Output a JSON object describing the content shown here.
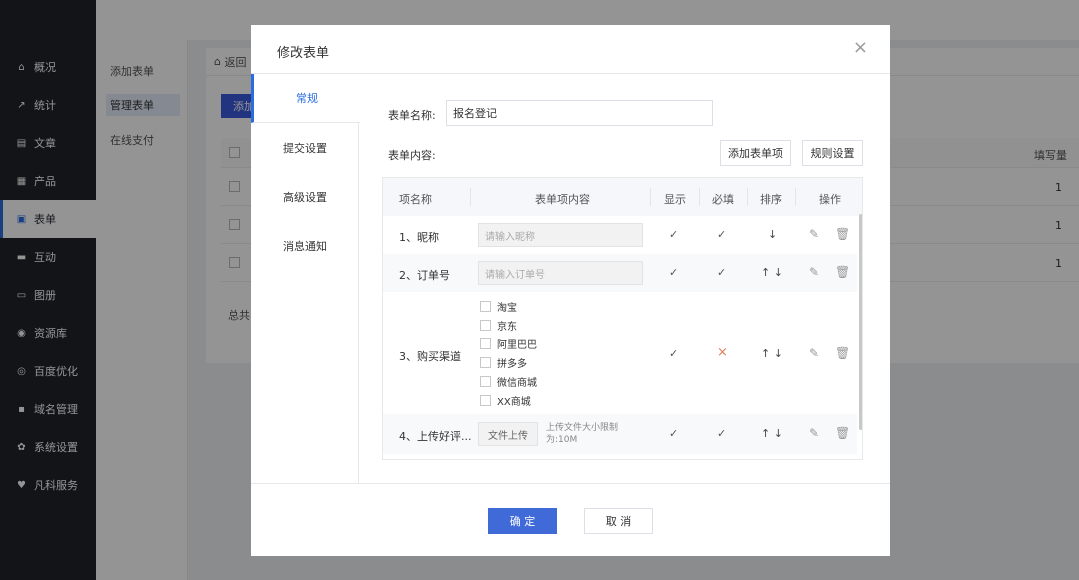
{
  "nav": {
    "items": [
      {
        "icon": "home-icon",
        "glyph": "⌂",
        "label": "概况"
      },
      {
        "icon": "chart-icon",
        "glyph": "↗",
        "label": "统计"
      },
      {
        "icon": "doc-icon",
        "glyph": "▤",
        "label": "文章"
      },
      {
        "icon": "grid-icon",
        "glyph": "▦",
        "label": "产品"
      },
      {
        "icon": "form-icon",
        "glyph": "▣",
        "label": "表单"
      },
      {
        "icon": "chat-icon",
        "glyph": "▬",
        "label": "互动"
      },
      {
        "icon": "image-icon",
        "glyph": "▭",
        "label": "图册"
      },
      {
        "icon": "database-icon",
        "glyph": "◉",
        "label": "资源库"
      },
      {
        "icon": "seo-icon",
        "glyph": "◎",
        "label": "百度优化"
      },
      {
        "icon": "domain-icon",
        "glyph": "▪",
        "label": "域名管理"
      },
      {
        "icon": "gear-icon",
        "glyph": "✿",
        "label": "系统设置"
      },
      {
        "icon": "heart-icon",
        "glyph": "♥",
        "label": "凡科服务"
      }
    ]
  },
  "submenu": {
    "items": [
      "添加表单",
      "管理表单",
      "在线支付"
    ]
  },
  "content": {
    "back": "返回",
    "add_btn": "添加",
    "fill_header": "填写量",
    "rows": [
      "1",
      "1",
      "1"
    ],
    "total": "总共"
  },
  "modal": {
    "title": "修改表单",
    "close": "×",
    "tabs": [
      "常规",
      "提交设置",
      "高级设置",
      "消息通知"
    ],
    "form_name_label": "表单名称:",
    "form_name_value": "报名登记",
    "form_content_label": "表单内容:",
    "add_item_btn": "添加表单项",
    "rule_btn": "规则设置",
    "grid": {
      "headers": [
        "项名称",
        "表单项内容",
        "显示",
        "必填",
        "排序",
        "操作"
      ],
      "rows": [
        {
          "name": "1、昵称",
          "placeholder": "请输入昵称",
          "show": "✓",
          "required": "✓",
          "sort": "↓"
        },
        {
          "name": "2、订单号",
          "placeholder": "请输入订单号",
          "show": "✓",
          "required": "✓",
          "sort": "↑ ↓"
        },
        {
          "name": "3、购买渠道",
          "options": [
            "淘宝",
            "京东",
            "阿里巴巴",
            "拼多多",
            "微信商城",
            "XX商城"
          ],
          "show": "✓",
          "required": "×",
          "sort": "↑ ↓"
        },
        {
          "name": "4、上传好评...",
          "upload": "文件上传",
          "hint": "上传文件大小限制为:10M",
          "show": "✓",
          "required": "✓",
          "sort": "↑ ↓"
        }
      ]
    },
    "ok": "确 定",
    "cancel": "取 消"
  }
}
